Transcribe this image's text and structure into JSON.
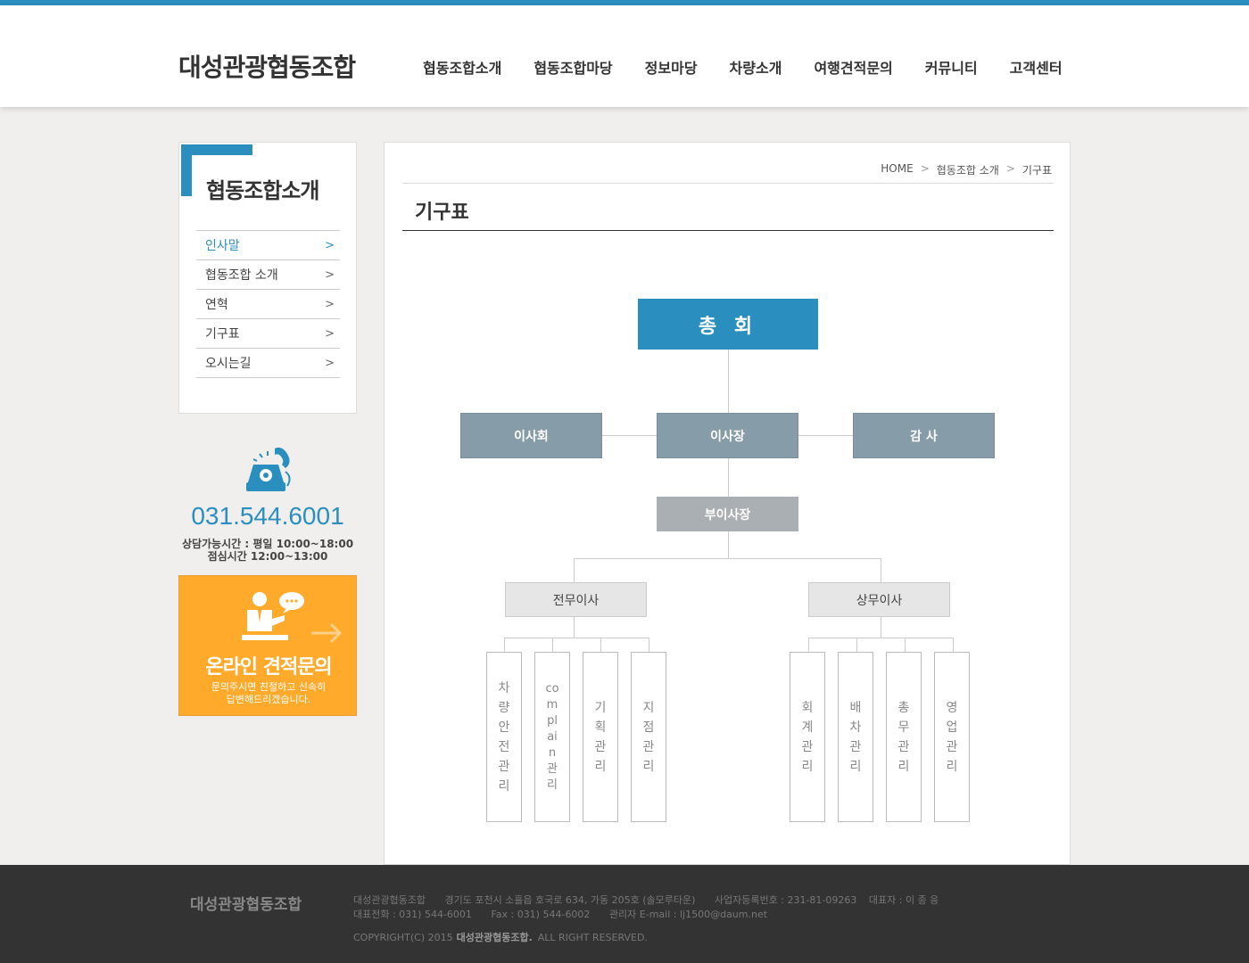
{
  "header": {
    "logo": "대성관광협동조합",
    "nav": [
      "협동조합소개",
      "협동조합마당",
      "정보마당",
      "차량소개",
      "여행견적문의",
      "커뮤니티",
      "고객센터"
    ]
  },
  "sidebar": {
    "title": "협동조합소개",
    "items": [
      {
        "label": "인사말",
        "active": true
      },
      {
        "label": "협동조합 소개"
      },
      {
        "label": "연혁"
      },
      {
        "label": "기구표"
      },
      {
        "label": "오시는길"
      }
    ],
    "phone": "031.544.6001",
    "hours1": "상담가능시간 : 평일 10:00~18:00",
    "hours2": "점심시간 12:00~13:00",
    "quote_title": "온라인 견적문의",
    "quote_desc1": "문의주시면 친절하고 신속히",
    "quote_desc2": "답변해드리겠습니다."
  },
  "breadcrumb": {
    "home": "HOME",
    "level1": "협동조합 소개",
    "level2": "기구표"
  },
  "page_title": "기구표",
  "org": {
    "general": "총 회",
    "board": "이사회",
    "chairman": "이사장",
    "auditor": "감 사",
    "vice": "부이사장",
    "exec1": "전무이사",
    "exec2": "상무이사",
    "depts1": [
      "차량안전관리",
      "complain관리",
      "기획관리",
      "지점관리"
    ],
    "depts2": [
      "회계관리",
      "배차관리",
      "총무관리",
      "영업관리"
    ]
  },
  "footer": {
    "logo": "대성관광협동조합",
    "company": "대성관광협동조합",
    "address": "경기도 포천시 소흘읍 호국로 634, 가동 205호 (솔모루타운)",
    "bizno": "사업자등록번호 : 231-81-09263",
    "ceo": "대표자 : 이 종 응",
    "tel": "대표전화 : 031) 544-6001",
    "fax": "Fax : 031) 544-6002",
    "email": "관리자 E-mail : lj1500@daum.net",
    "copy_prefix": "COPYRIGHT(C) 2015",
    "copy_name": "대성관광협동조합.",
    "copy_suffix": "ALL RIGHT RESERVED."
  }
}
